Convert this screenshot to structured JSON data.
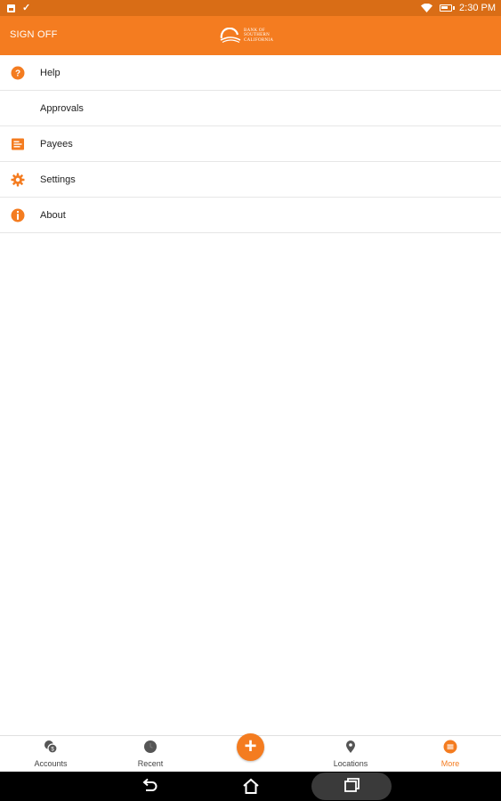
{
  "status_bar": {
    "time": "2:30 PM",
    "icons": [
      "image-notification-icon",
      "check-notification-icon",
      "wifi-icon",
      "battery-icon"
    ]
  },
  "header": {
    "sign_off_label": "SIGN OFF",
    "logo": {
      "lines": [
        "BANK OF",
        "SOUTHERN",
        "CALIFORNIA"
      ],
      "icon": "bank-logo-icon"
    },
    "background_color": "#f47c20"
  },
  "menu": {
    "items": [
      {
        "label": "Help",
        "icon": "help-icon"
      },
      {
        "label": "Approvals",
        "icon": ""
      },
      {
        "label": "Payees",
        "icon": "payees-icon"
      },
      {
        "label": "Settings",
        "icon": "gear-icon"
      },
      {
        "label": "About",
        "icon": "info-icon"
      }
    ]
  },
  "bottom_nav": {
    "tabs": [
      {
        "label": "Accounts",
        "icon": "accounts-icon",
        "active": false
      },
      {
        "label": "Recent",
        "icon": "recent-icon",
        "active": false
      },
      {
        "label": "Locations",
        "icon": "location-pin-icon",
        "active": false
      },
      {
        "label": "More",
        "icon": "more-icon",
        "active": true
      }
    ],
    "fab_label": "+",
    "accent_color": "#f47c20"
  },
  "system_nav": {
    "buttons": [
      "back-icon",
      "home-icon",
      "recent-apps-icon"
    ]
  }
}
